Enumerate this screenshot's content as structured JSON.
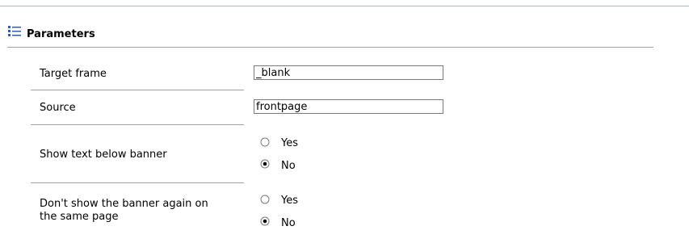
{
  "section": {
    "title": "Parameters",
    "icon": "list-icon"
  },
  "fields": {
    "target_frame": {
      "label": "Target frame",
      "value": "_blank"
    },
    "source": {
      "label": "Source",
      "value": "frontpage"
    },
    "show_text": {
      "label": "Show text below banner",
      "options": [
        "Yes",
        "No"
      ],
      "selected": "No"
    },
    "dont_show_again": {
      "label_line1": "Don't show the banner again on",
      "label_line2": "the same page",
      "options": [
        "Yes",
        "No"
      ],
      "selected": "No"
    }
  },
  "colors": {
    "accent_icon": "#2a5cc8",
    "rule": "#a0a0a0",
    "top_rule": "#a7b6cc"
  }
}
